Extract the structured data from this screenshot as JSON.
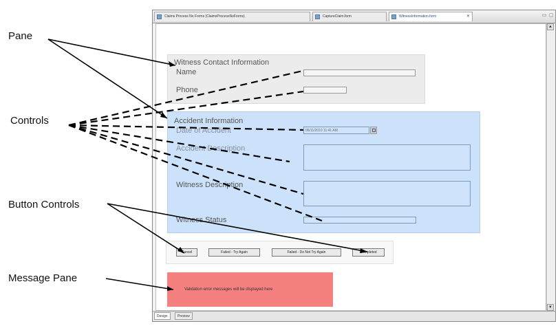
{
  "callouts": {
    "pane": "Pane",
    "controls": "Controls",
    "button_controls": "Button Controls",
    "message_pane": "Message Pane"
  },
  "window": {
    "tabs": [
      {
        "label": "Claims Process No Forms (ClaimsProcessNoForms)",
        "active": false
      },
      {
        "label": "CaptureClaim.form",
        "active": false
      },
      {
        "label": "WitnessInformation.form",
        "active": true
      }
    ],
    "bottom_tabs": [
      "Design",
      "Preview"
    ]
  },
  "witness_pane": {
    "title": "Witness Contact Information",
    "name_label": "Name",
    "phone_label": "Phone"
  },
  "accident_pane": {
    "title": "Accident Information",
    "date_label": "Date of Accident",
    "date_value": "06/11/2010 11:41 AM",
    "accident_desc_label": "Accident Description",
    "witness_desc_label": "Witness Description",
    "witness_status_label": "Witness Status"
  },
  "buttons": [
    "Cancel",
    "Failed - Try Again",
    "Failed - Do Not Try Again",
    "Completed"
  ],
  "message_pane": {
    "text": "Validation error messages will be displayed here"
  },
  "colors": {
    "accident_pane": "#cce2fb",
    "witness_pane": "#ececec",
    "message_pane": "#f58080",
    "canvas": "#ffffff"
  }
}
